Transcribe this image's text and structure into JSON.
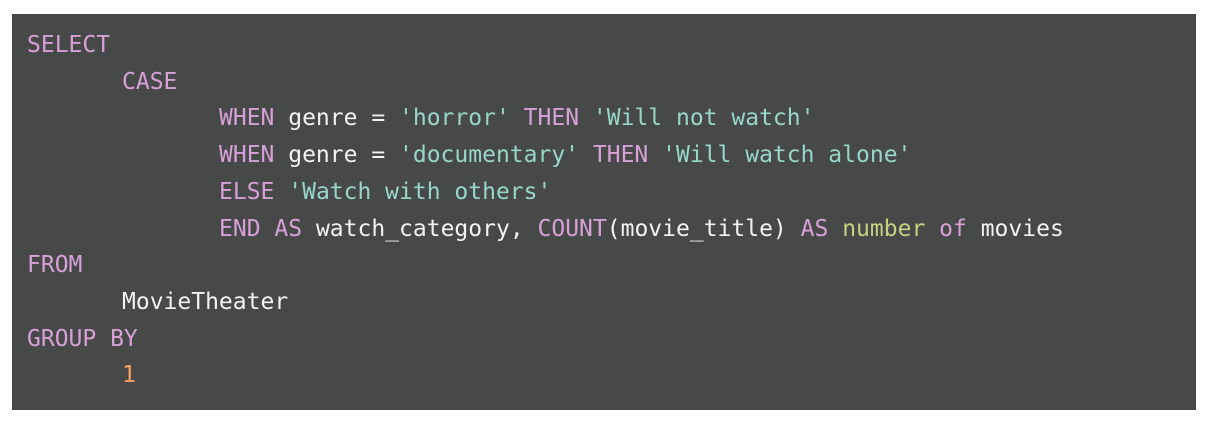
{
  "code": {
    "language": "sql",
    "colors": {
      "background": "#474949",
      "keyword": "#d7a0d6",
      "string": "#98d6c9",
      "number": "#f7a062",
      "identifier": "#f2f2f2",
      "type_keyword": "#c9cf83"
    },
    "lines": [
      {
        "indent": 0,
        "tokens": [
          {
            "t": "kw",
            "v": "SELECT"
          }
        ]
      },
      {
        "indent": 1,
        "tokens": [
          {
            "t": "kw",
            "v": "CASE"
          }
        ]
      },
      {
        "indent": 2,
        "tokens": [
          {
            "t": "kw",
            "v": "WHEN"
          },
          {
            "t": "plain",
            "v": " genre = "
          },
          {
            "t": "str",
            "v": "'horror'"
          },
          {
            "t": "plain",
            "v": " "
          },
          {
            "t": "kw",
            "v": "THEN"
          },
          {
            "t": "plain",
            "v": " "
          },
          {
            "t": "str",
            "v": "'Will not watch'"
          }
        ]
      },
      {
        "indent": 2,
        "tokens": [
          {
            "t": "kw",
            "v": "WHEN"
          },
          {
            "t": "plain",
            "v": " genre = "
          },
          {
            "t": "str",
            "v": "'documentary'"
          },
          {
            "t": "plain",
            "v": " "
          },
          {
            "t": "kw",
            "v": "THEN"
          },
          {
            "t": "plain",
            "v": " "
          },
          {
            "t": "str",
            "v": "'Will watch alone'"
          }
        ]
      },
      {
        "indent": 2,
        "tokens": [
          {
            "t": "kw",
            "v": "ELSE"
          },
          {
            "t": "plain",
            "v": " "
          },
          {
            "t": "str",
            "v": "'Watch with others'"
          }
        ]
      },
      {
        "indent": 2,
        "tokens": [
          {
            "t": "kw",
            "v": "END"
          },
          {
            "t": "plain",
            "v": " "
          },
          {
            "t": "kw",
            "v": "AS"
          },
          {
            "t": "plain",
            "v": " watch_category, "
          },
          {
            "t": "kw",
            "v": "COUNT"
          },
          {
            "t": "plain",
            "v": "(movie_title) "
          },
          {
            "t": "kw",
            "v": "AS"
          },
          {
            "t": "plain",
            "v": " "
          },
          {
            "t": "type",
            "v": "number"
          },
          {
            "t": "plain",
            "v": " "
          },
          {
            "t": "kw",
            "v": "of"
          },
          {
            "t": "plain",
            "v": " movies"
          }
        ]
      },
      {
        "indent": 0,
        "tokens": [
          {
            "t": "kw",
            "v": "FROM"
          }
        ]
      },
      {
        "indent": 1,
        "tokens": [
          {
            "t": "plain",
            "v": "MovieTheater"
          }
        ]
      },
      {
        "indent": 0,
        "tokens": [
          {
            "t": "kw",
            "v": "GROUP BY"
          }
        ]
      },
      {
        "indent": 1,
        "tokens": [
          {
            "t": "num",
            "v": "1"
          }
        ]
      }
    ]
  }
}
